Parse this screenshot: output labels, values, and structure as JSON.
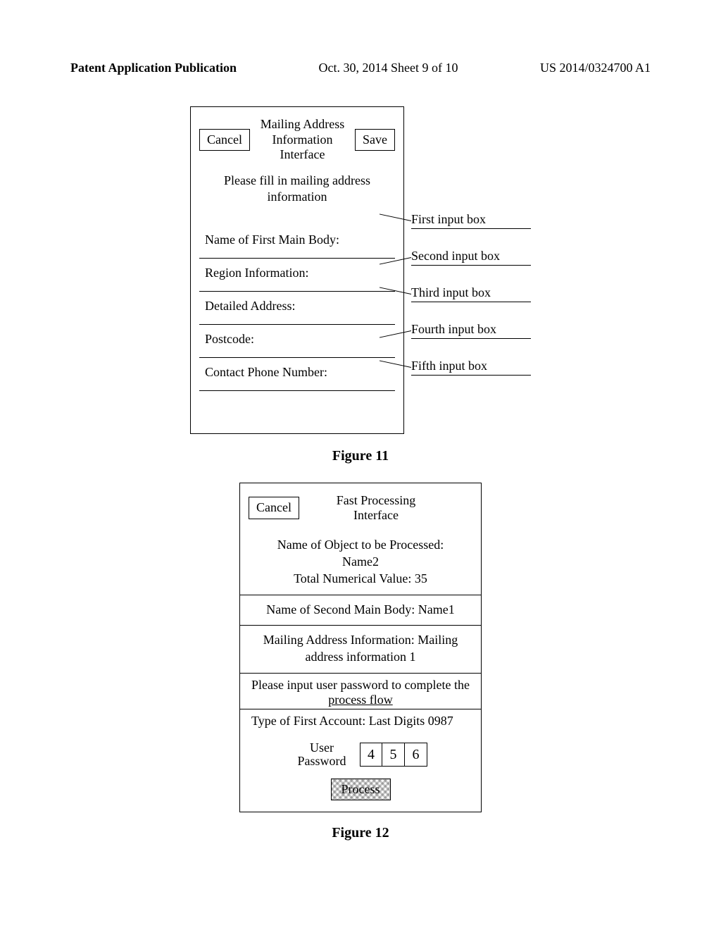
{
  "header": {
    "left": "Patent Application Publication",
    "mid": "Oct. 30, 2014  Sheet 9 of 10",
    "right": "US 2014/0324700 A1"
  },
  "fig11": {
    "cancel_label": "Cancel",
    "save_label": "Save",
    "title_line1": "Mailing Address",
    "title_line2": "Information",
    "title_line3": "Interface",
    "instruct_line1": "Please fill in mailing address",
    "instruct_line2": "information",
    "fields": {
      "name": "Name of First Main Body:",
      "region": "Region Information:",
      "detailed": "Detailed Address:",
      "postcode": "Postcode:",
      "phone": "Contact Phone Number:"
    },
    "notes": {
      "first": "First input box",
      "second": "Second input box",
      "third": "Third input box",
      "fourth": "Fourth input box",
      "fifth": "Fifth input box"
    },
    "caption": "Figure 11"
  },
  "fig12": {
    "cancel_label": "Cancel",
    "title_line1": "Fast Processing",
    "title_line2": "Interface",
    "object_line1": "Name of Object to be Processed:",
    "object_line2": "Name2",
    "total_value": "Total Numerical Value: 35",
    "second_main": "Name of Second Main Body: Name1",
    "mailing_line1": "Mailing Address Information: Mailing",
    "mailing_line2": "address information 1",
    "prompt_line1": "Please input user password to complete the",
    "prompt_line2": "process flow",
    "account_type": "Type of First Account: Last Digits 0987",
    "pwd_label_line1": "User",
    "pwd_label_line2": "Password",
    "pwd_digits": {
      "d1": "4",
      "d2": "5",
      "d3": "6"
    },
    "process_label": "Process",
    "caption": "Figure 12"
  }
}
